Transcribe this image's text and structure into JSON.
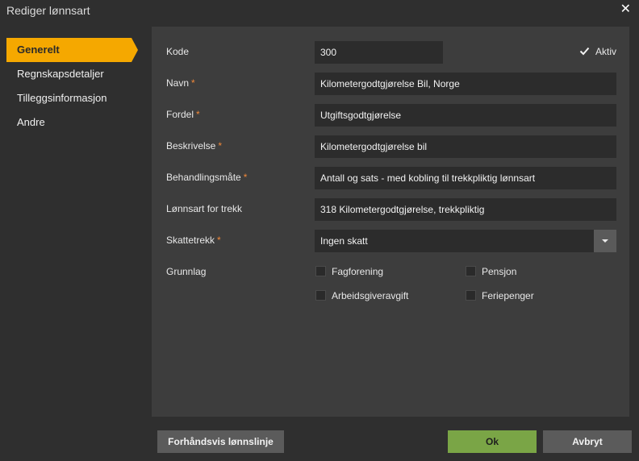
{
  "window": {
    "title": "Rediger lønnsart"
  },
  "sidebar": {
    "items": [
      {
        "label": "Generelt",
        "active": true
      },
      {
        "label": "Regnskapsdetaljer",
        "active": false
      },
      {
        "label": "Tilleggsinformasjon",
        "active": false
      },
      {
        "label": "Andre",
        "active": false
      }
    ]
  },
  "form": {
    "kode": {
      "label": "Kode",
      "value": "300"
    },
    "aktiv": {
      "label": "Aktiv",
      "checked": true
    },
    "navn": {
      "label": "Navn",
      "value": "Kilometergodtgjørelse Bil, Norge"
    },
    "fordel": {
      "label": "Fordel",
      "value": "Utgiftsgodtgjørelse"
    },
    "beskrivelse": {
      "label": "Beskrivelse",
      "value": "Kilometergodtgjørelse bil"
    },
    "behandlingsmate": {
      "label": "Behandlingsmåte",
      "value": "Antall og sats - med kobling til trekkpliktig lønnsart"
    },
    "lonnsart_trekk": {
      "label": "Lønnsart for trekk",
      "value": "318 Kilometergodtgjørelse, trekkpliktig"
    },
    "skattetrekk": {
      "label": "Skattetrekk",
      "value": "Ingen skatt"
    },
    "grunnlag": {
      "label": "Grunnlag",
      "options": [
        {
          "label": "Fagforening",
          "checked": false
        },
        {
          "label": "Pensjon",
          "checked": false
        },
        {
          "label": "Arbeidsgiveravgift",
          "checked": false
        },
        {
          "label": "Feriepenger",
          "checked": false
        }
      ]
    },
    "required_marker": "*"
  },
  "footer": {
    "preview_label": "Forhåndsvis lønnslinje",
    "ok_label": "Ok",
    "cancel_label": "Avbryt"
  },
  "colors": {
    "accent": "#f5a800",
    "ok_button": "#7aa546",
    "required": "#f0883a"
  }
}
